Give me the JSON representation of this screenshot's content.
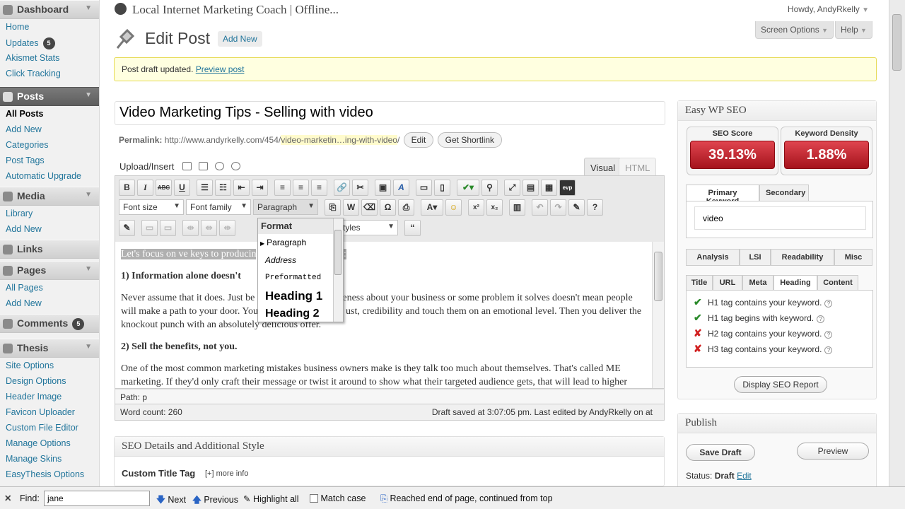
{
  "site_title": "Local Internet Marketing Coach | Offline...",
  "howdy": "Howdy, AndyRkelly",
  "screen_options": "Screen Options",
  "help": "Help",
  "page_title": "Edit Post",
  "add_new": "Add New",
  "notice": {
    "text": "Post draft updated.",
    "link": "Preview post"
  },
  "sidebar": {
    "dashboard": {
      "label": "Dashboard",
      "items": [
        "Home",
        "Updates",
        "Akismet Stats",
        "Click Tracking"
      ],
      "updates_count": "5"
    },
    "posts": {
      "label": "Posts",
      "items": [
        "All Posts",
        "Add New",
        "Categories",
        "Post Tags",
        "Automatic Upgrade"
      ]
    },
    "media": {
      "label": "Media",
      "items": [
        "Library",
        "Add New"
      ]
    },
    "links": {
      "label": "Links"
    },
    "pages": {
      "label": "Pages",
      "items": [
        "All Pages",
        "Add New"
      ]
    },
    "comments": {
      "label": "Comments",
      "count": "5"
    },
    "thesis": {
      "label": "Thesis",
      "items": [
        "Site Options",
        "Design Options",
        "Header Image",
        "Favicon Uploader",
        "Custom File Editor",
        "Manage Options",
        "Manage Skins",
        "EasyThesis Options"
      ]
    }
  },
  "post": {
    "title": "Video Marketing Tips - Selling with video",
    "permalink_label": "Permalink:",
    "permalink_base": "http://www.andyrkelly.com/454/",
    "permalink_slug": "video-marketin…ing-with-video",
    "permalink_end": "/",
    "edit_btn": "Edit",
    "shortlink_btn": "Get Shortlink"
  },
  "editor": {
    "upload_insert": "Upload/Insert",
    "tab_visual": "Visual",
    "tab_html": "HTML",
    "font_size": "Font size",
    "font_family": "Font family",
    "format": "Paragraph",
    "styles": "Styles",
    "content": {
      "p1_sel_a": "Let's focus on ",
      "p1_sel_b": "ve keys to producin",
      "p1_sel_c": "sell:",
      "h1": "1) Information alone doesn't",
      "p2a": "Never assume that it does. Just be",
      "p2b": "eness about your business or some problem it solves doesn't mean people will make a path to your door. You",
      "p2c": "ust, credibility and touch them on an emotional level. Then you deliver the knockout punch with an absolutely delicious offer.",
      "h2": "2) Sell the benefits, not you.",
      "p3": "One of the most common marketing mistakes business owners make is they talk too much about themselves. That's called ME marketing. If they'd only craft their message or twist it around to show what their targeted audience gets, that will lead to higher"
    },
    "path": "Path: p",
    "word_count": "Word count: 260",
    "draft_saved": "Draft saved at 3:07:05 pm. Last edited by AndyRkelly on at"
  },
  "format_menu": {
    "header": "Format",
    "items": [
      "Paragraph",
      "Address",
      "Preformatted",
      "Heading 1",
      "Heading 2"
    ]
  },
  "seo_details": {
    "title": "SEO Details and Additional Style",
    "custom_title": "Custom Title Tag",
    "more_info": "[+] more info"
  },
  "easy_seo": {
    "title": "Easy WP SEO",
    "seo_score_label": "SEO Score",
    "seo_score": "39.13%",
    "density_label": "Keyword Density",
    "density": "1.88%",
    "kw_tabs": [
      "Primary Keyword",
      "Secondary"
    ],
    "keyword": "video",
    "tabs1": [
      "Analysis",
      "LSI",
      "Readability",
      "Misc"
    ],
    "tabs2": [
      "Title",
      "URL",
      "Meta",
      "Heading",
      "Content"
    ],
    "checks": [
      {
        "text": "H1 tag contains your keyword.",
        "ok": true
      },
      {
        "text": "H1 tag begins with keyword.",
        "ok": true
      },
      {
        "text": "H2 tag contains your keyword.",
        "ok": false
      },
      {
        "text": "H3 tag contains your keyword.",
        "ok": false
      }
    ],
    "report_btn": "Display SEO Report"
  },
  "publish": {
    "title": "Publish",
    "save_draft": "Save Draft",
    "preview": "Preview",
    "status_label": "Status:",
    "status": "Draft",
    "status_edit": "Edit"
  },
  "findbar": {
    "find_label": "Find:",
    "query": "jane",
    "next": "Next",
    "previous": "Previous",
    "highlight": "Highlight all",
    "match_case": "Match case",
    "message": "Reached end of page, continued from top"
  }
}
